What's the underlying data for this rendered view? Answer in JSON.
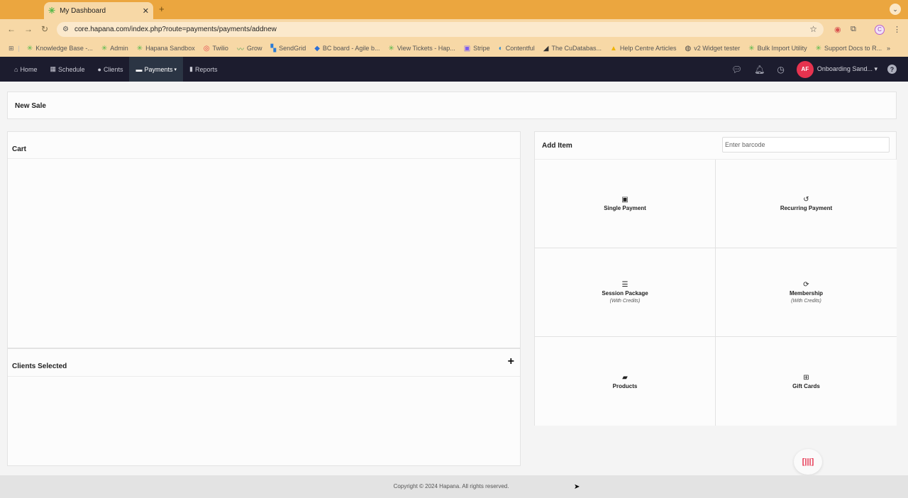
{
  "browser": {
    "tab_title": "My Dashboard",
    "new_tab": "+",
    "url": "core.hapana.com/index.php?route=payments/payments/addnew",
    "bookmarks": [
      {
        "label": "Knowledge Base -...",
        "icon": "hapana-icon"
      },
      {
        "label": "Admin",
        "icon": "hapana-icon"
      },
      {
        "label": "Hapana Sandbox",
        "icon": "hapana-icon"
      },
      {
        "label": "Twilio",
        "icon": "twilio-icon"
      },
      {
        "label": "Grow",
        "icon": "grow-icon"
      },
      {
        "label": "SendGrid",
        "icon": "sendgrid-icon"
      },
      {
        "label": "BC board - Agile b...",
        "icon": "jira-icon"
      },
      {
        "label": "View Tickets - Hap...",
        "icon": "hapana-icon"
      },
      {
        "label": "Stripe",
        "icon": "stripe-icon"
      },
      {
        "label": "Contentful",
        "icon": "contentful-icon"
      },
      {
        "label": "The CuDatabas...",
        "icon": "notion-icon"
      },
      {
        "label": "Help Centre Articles",
        "icon": "drive-icon"
      },
      {
        "label": "v2 Widget tester",
        "icon": "globe-icon"
      },
      {
        "label": "Bulk Import Utility",
        "icon": "hapana-icon"
      },
      {
        "label": "Support Docs to R...",
        "icon": "hapana-icon"
      }
    ],
    "more": "»"
  },
  "navbar": {
    "items": [
      {
        "label": "Home",
        "icon": "home-icon"
      },
      {
        "label": "Schedule",
        "icon": "calendar-icon"
      },
      {
        "label": "Clients",
        "icon": "user-icon"
      },
      {
        "label": "Payments",
        "icon": "payments-icon"
      },
      {
        "label": "Reports",
        "icon": "bar-chart-icon"
      }
    ],
    "avatar_initials": "AF",
    "account_name": "Onboarding Sand..."
  },
  "main": {
    "page_title": "New Sale",
    "cart_title": "Cart",
    "clients_title": "Clients Selected",
    "add_item_title": "Add Item",
    "barcode_placeholder": "Enter barcode",
    "items": [
      {
        "label": "Single Payment",
        "sub": "",
        "icon": "cash-icon"
      },
      {
        "label": "Recurring Payment",
        "sub": "",
        "icon": "undo-icon"
      },
      {
        "label": "Session Package",
        "sub": "(With Credits)",
        "icon": "list-icon"
      },
      {
        "label": "Membership",
        "sub": "(With Credits)",
        "icon": "refresh-icon"
      },
      {
        "label": "Products",
        "sub": "",
        "icon": "briefcase-icon"
      },
      {
        "label": "Gift Cards",
        "sub": "",
        "icon": "gift-icon"
      }
    ]
  },
  "footer": {
    "copyright": "Copyright © 2024 Hapana. All rights reserved."
  },
  "colors": {
    "browser_accent": "#eba63f",
    "nav_bg": "#1c1c2e",
    "avatar": "#e6334f"
  }
}
